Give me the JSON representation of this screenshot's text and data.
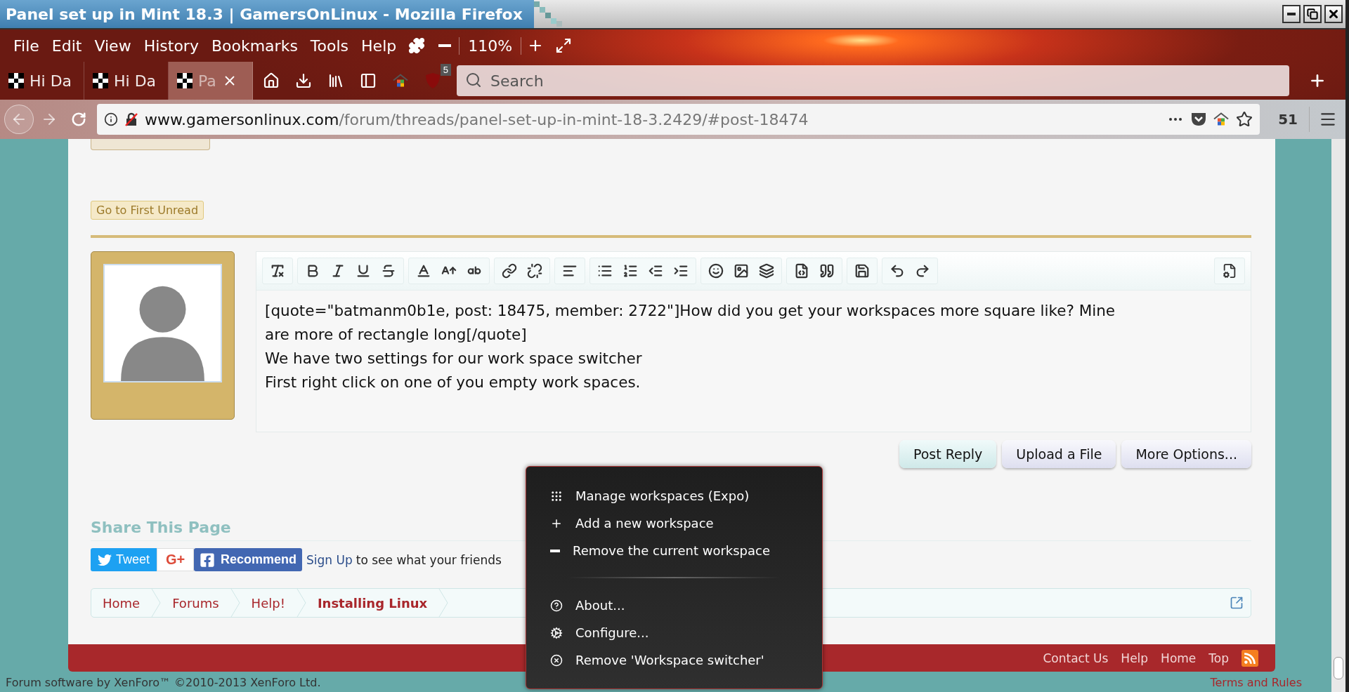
{
  "window": {
    "title": "Panel set up in Mint 18.3 | GamersOnLinux - Mozilla Firefox"
  },
  "menu_bar": {
    "items": [
      "File",
      "Edit",
      "View",
      "History",
      "Bookmarks",
      "Tools",
      "Help"
    ],
    "zoom": "110%"
  },
  "tabs": [
    {
      "label": "Hi Da",
      "selected": false
    },
    {
      "label": "Hi Da",
      "selected": false
    },
    {
      "label": "Pa",
      "selected": true
    }
  ],
  "toolbar": {
    "blocker_badge": "5",
    "search": {
      "placeholder": "Search"
    }
  },
  "address_bar": {
    "domain": "www.gamersonlinux.com",
    "path": "/forum/threads/panel-set-up-in-mint-18-3.2429/#post-18474",
    "counter": "51"
  },
  "page": {
    "go_to_first_unread": "Go to First Unread",
    "editor": {
      "lines": [
        "[quote=\"batmanm0b1e, post: 18475, member: 2722\"]How did you get your workspaces more square like? Mine",
        "are more of rectangle long[/quote]",
        "We have two settings for our work space switcher",
        "First right click on one of you empty work spaces."
      ]
    },
    "buttons": [
      {
        "label": "Post Reply",
        "primary": true
      },
      {
        "label": "Upload a File",
        "primary": false
      },
      {
        "label": "More Options...",
        "primary": false
      }
    ],
    "share": {
      "title": "Share This Page",
      "tweet": "Tweet",
      "google_plus": "G+",
      "recommend": "Recommend",
      "sign_up": "Sign Up",
      "sign_up_rest": "to see what your friends"
    },
    "breadcrumb": [
      {
        "label": "Home",
        "selected": false
      },
      {
        "label": "Forums",
        "selected": false
      },
      {
        "label": "Help!",
        "selected": false
      },
      {
        "label": "Installing Linux",
        "selected": true
      }
    ],
    "footer_links": [
      "Contact Us",
      "Help",
      "Home",
      "Top"
    ],
    "copyright": "Forum software by XenForo™ ©2010-2013 XenForo Ltd.",
    "terms": "Terms and Rules"
  },
  "context_menu": {
    "items": [
      {
        "kind": "item",
        "label": "Manage workspaces (Expo)"
      },
      {
        "kind": "item",
        "label": "Add a new workspace"
      },
      {
        "kind": "item",
        "label": "Remove the current workspace"
      },
      {
        "kind": "separator"
      },
      {
        "kind": "item",
        "label": "About..."
      },
      {
        "kind": "item",
        "label": "Configure..."
      },
      {
        "kind": "item",
        "label": "Remove 'Workspace switcher'"
      }
    ]
  }
}
